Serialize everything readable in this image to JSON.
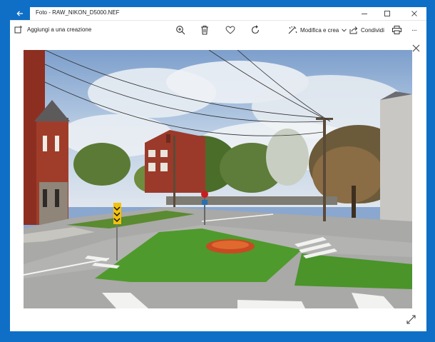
{
  "window": {
    "title": "Foto - RAW_NIKON_D5000.NEF",
    "controls": {
      "minimize": "minimize",
      "maximize": "maximize",
      "close": "close"
    }
  },
  "toolbar": {
    "add_to_creation": "Aggiungi a una creazione",
    "edit_create": "Modifica e crea",
    "share": "Condividi",
    "more": "···"
  },
  "colors": {
    "accent": "#0f6fc6",
    "titlebar_bg": "#ffffff",
    "icon": "#333333"
  },
  "icons": [
    "back-arrow-icon",
    "add-to-creation-icon",
    "zoom-in-icon",
    "delete-icon",
    "favorite-heart-icon",
    "rotate-icon",
    "edit-create-icon",
    "chevron-down-icon",
    "share-icon",
    "print-icon",
    "close-viewer-icon",
    "expand-icon"
  ]
}
